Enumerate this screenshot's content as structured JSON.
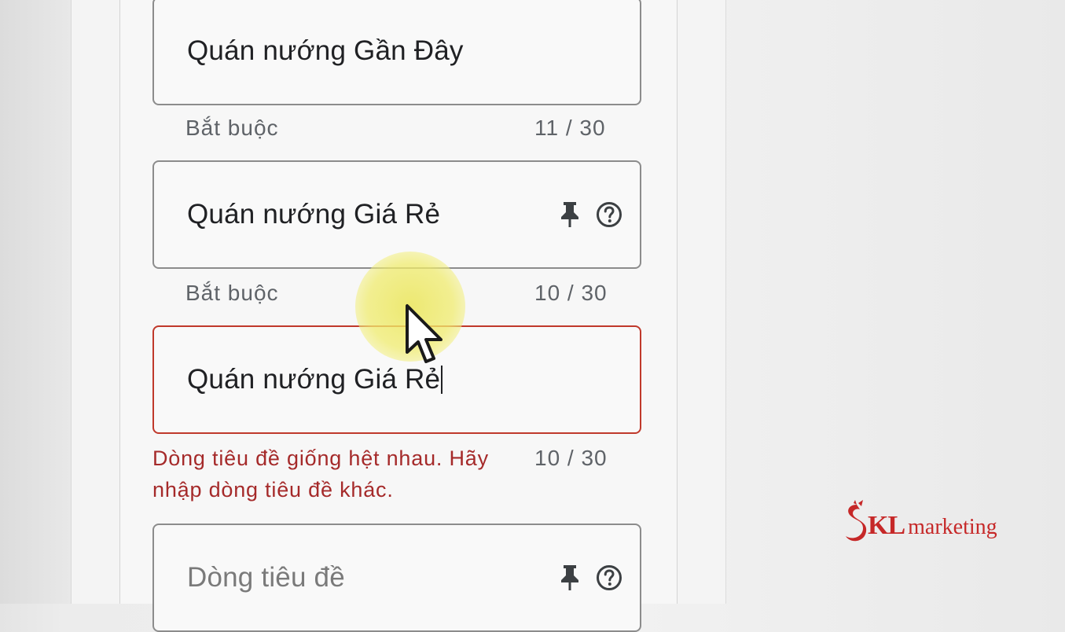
{
  "fields": [
    {
      "value": "Quán nướng Gần Đây",
      "helper": "Bắt buộc",
      "counter": "11 / 30"
    },
    {
      "value": "Quán nướng Giá Rẻ",
      "helper": "Bắt buộc",
      "counter": "10 / 30"
    },
    {
      "value": "Quán nướng Giá Rẻ",
      "error_line1": "Dòng tiêu đề giống hệt nhau. Hãy",
      "error_line2": "nhập dòng tiêu đề khác.",
      "counter": "10 / 30"
    },
    {
      "placeholder": "Dòng tiêu đề"
    }
  ],
  "icons": {
    "pin": "pin-icon",
    "help": "help-icon"
  },
  "colors": {
    "error": "#c0392b",
    "logo": "#c62828",
    "cursor_highlight": "#ebe65a"
  },
  "watermark": {
    "brand_kl": "KL",
    "brand_word": "marketing"
  }
}
